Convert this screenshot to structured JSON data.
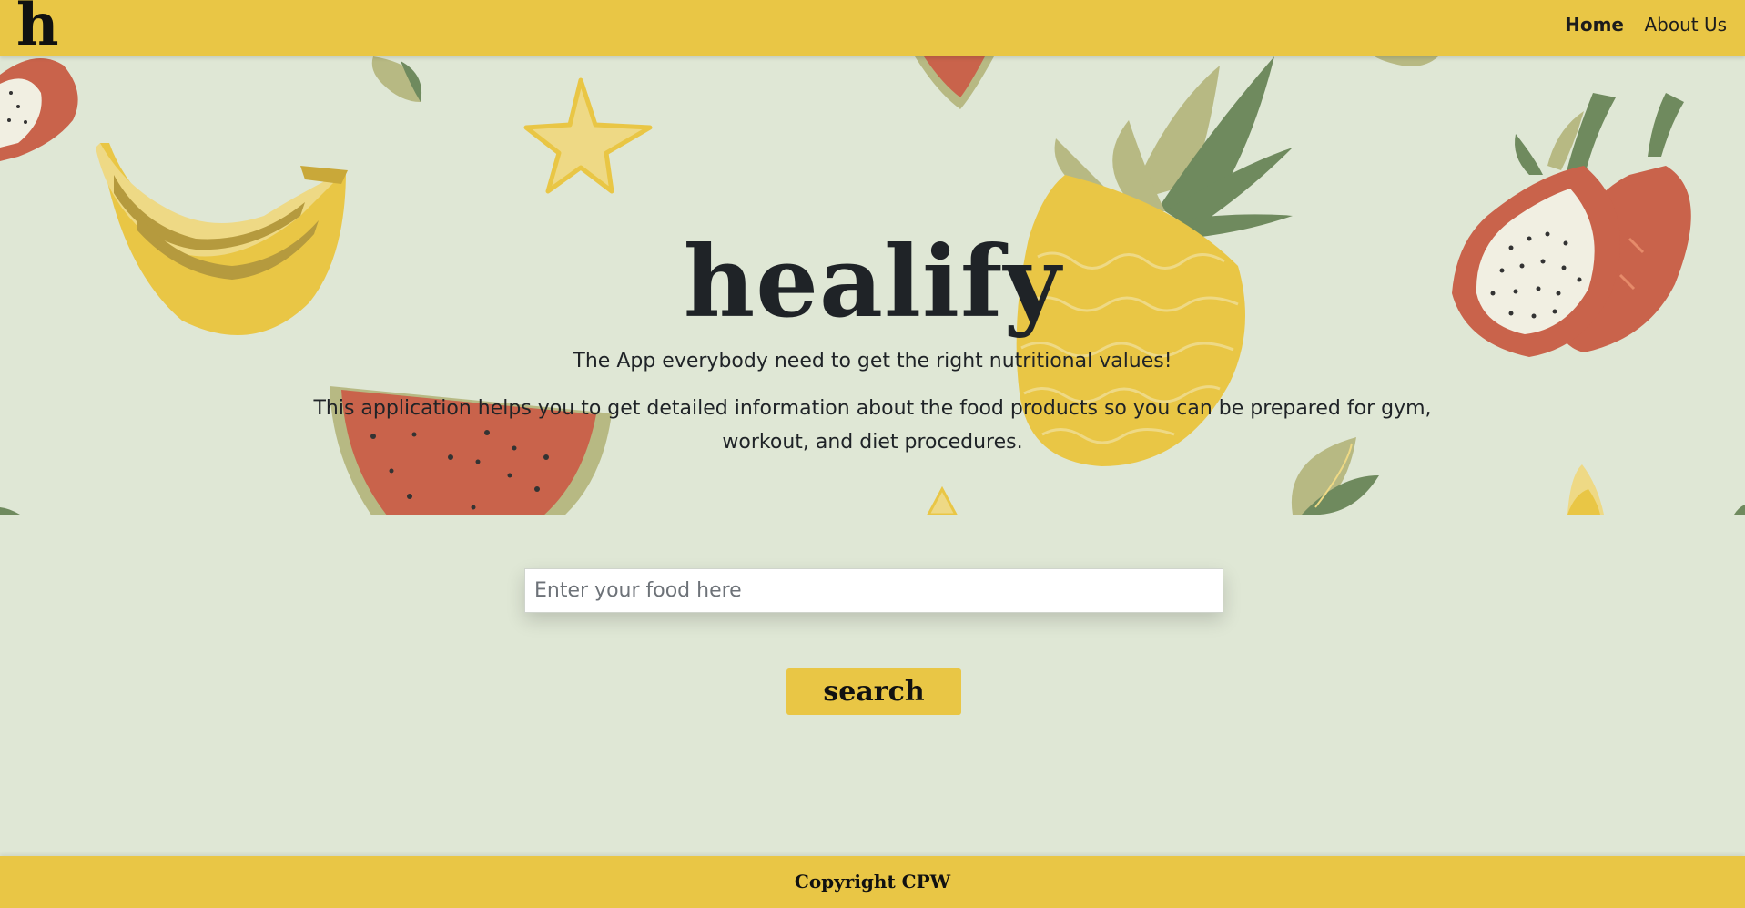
{
  "navbar": {
    "brand": "h",
    "links": [
      {
        "label": "Home",
        "active": true
      },
      {
        "label": "About Us",
        "active": false
      }
    ]
  },
  "hero": {
    "title": "healify",
    "tagline": "The App everybody need to get the right nutritional values!",
    "description": "This application helps you to get detailed information about the food products so you can be prepared for gym, workout, and diet procedures."
  },
  "search": {
    "placeholder": "Enter your food here",
    "value": "",
    "button_label": "search"
  },
  "footer": {
    "text": "Copyright CPW"
  },
  "colors": {
    "accent": "#e9c645",
    "background": "#dfe7d5",
    "text": "#1f2327",
    "watermelon": "#c9634b",
    "leaf": "#6f8a5e"
  },
  "decorations": [
    "banana-icon",
    "star-fruit-icon",
    "pineapple-icon",
    "watermelon-icon",
    "dragon-fruit-icon",
    "leaf-icon"
  ]
}
